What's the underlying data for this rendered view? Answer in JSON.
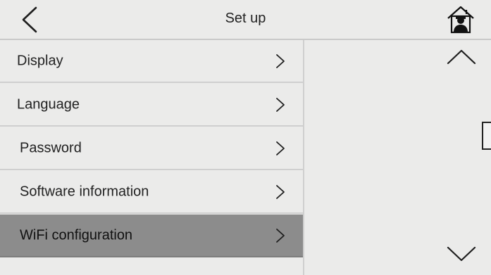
{
  "header": {
    "title": "Set up",
    "back_icon": "chevron-left-icon",
    "home_icon": "home-user-icon"
  },
  "menu": {
    "items": [
      {
        "label": "Display",
        "selected": false
      },
      {
        "label": "Language",
        "selected": false
      },
      {
        "label": "Password",
        "selected": false
      },
      {
        "label": "Software information",
        "selected": false
      },
      {
        "label": "WiFi configuration",
        "selected": true
      }
    ],
    "item_icon": "chevron-right-icon"
  },
  "right_pane": {
    "scroll_up_icon": "chevron-up-icon",
    "scroll_down_icon": "chevron-down-icon"
  },
  "colors": {
    "background": "#ebebea",
    "selected": "#8c8c8c",
    "divider": "#cfcfcf",
    "text": "#1e1e1e"
  }
}
